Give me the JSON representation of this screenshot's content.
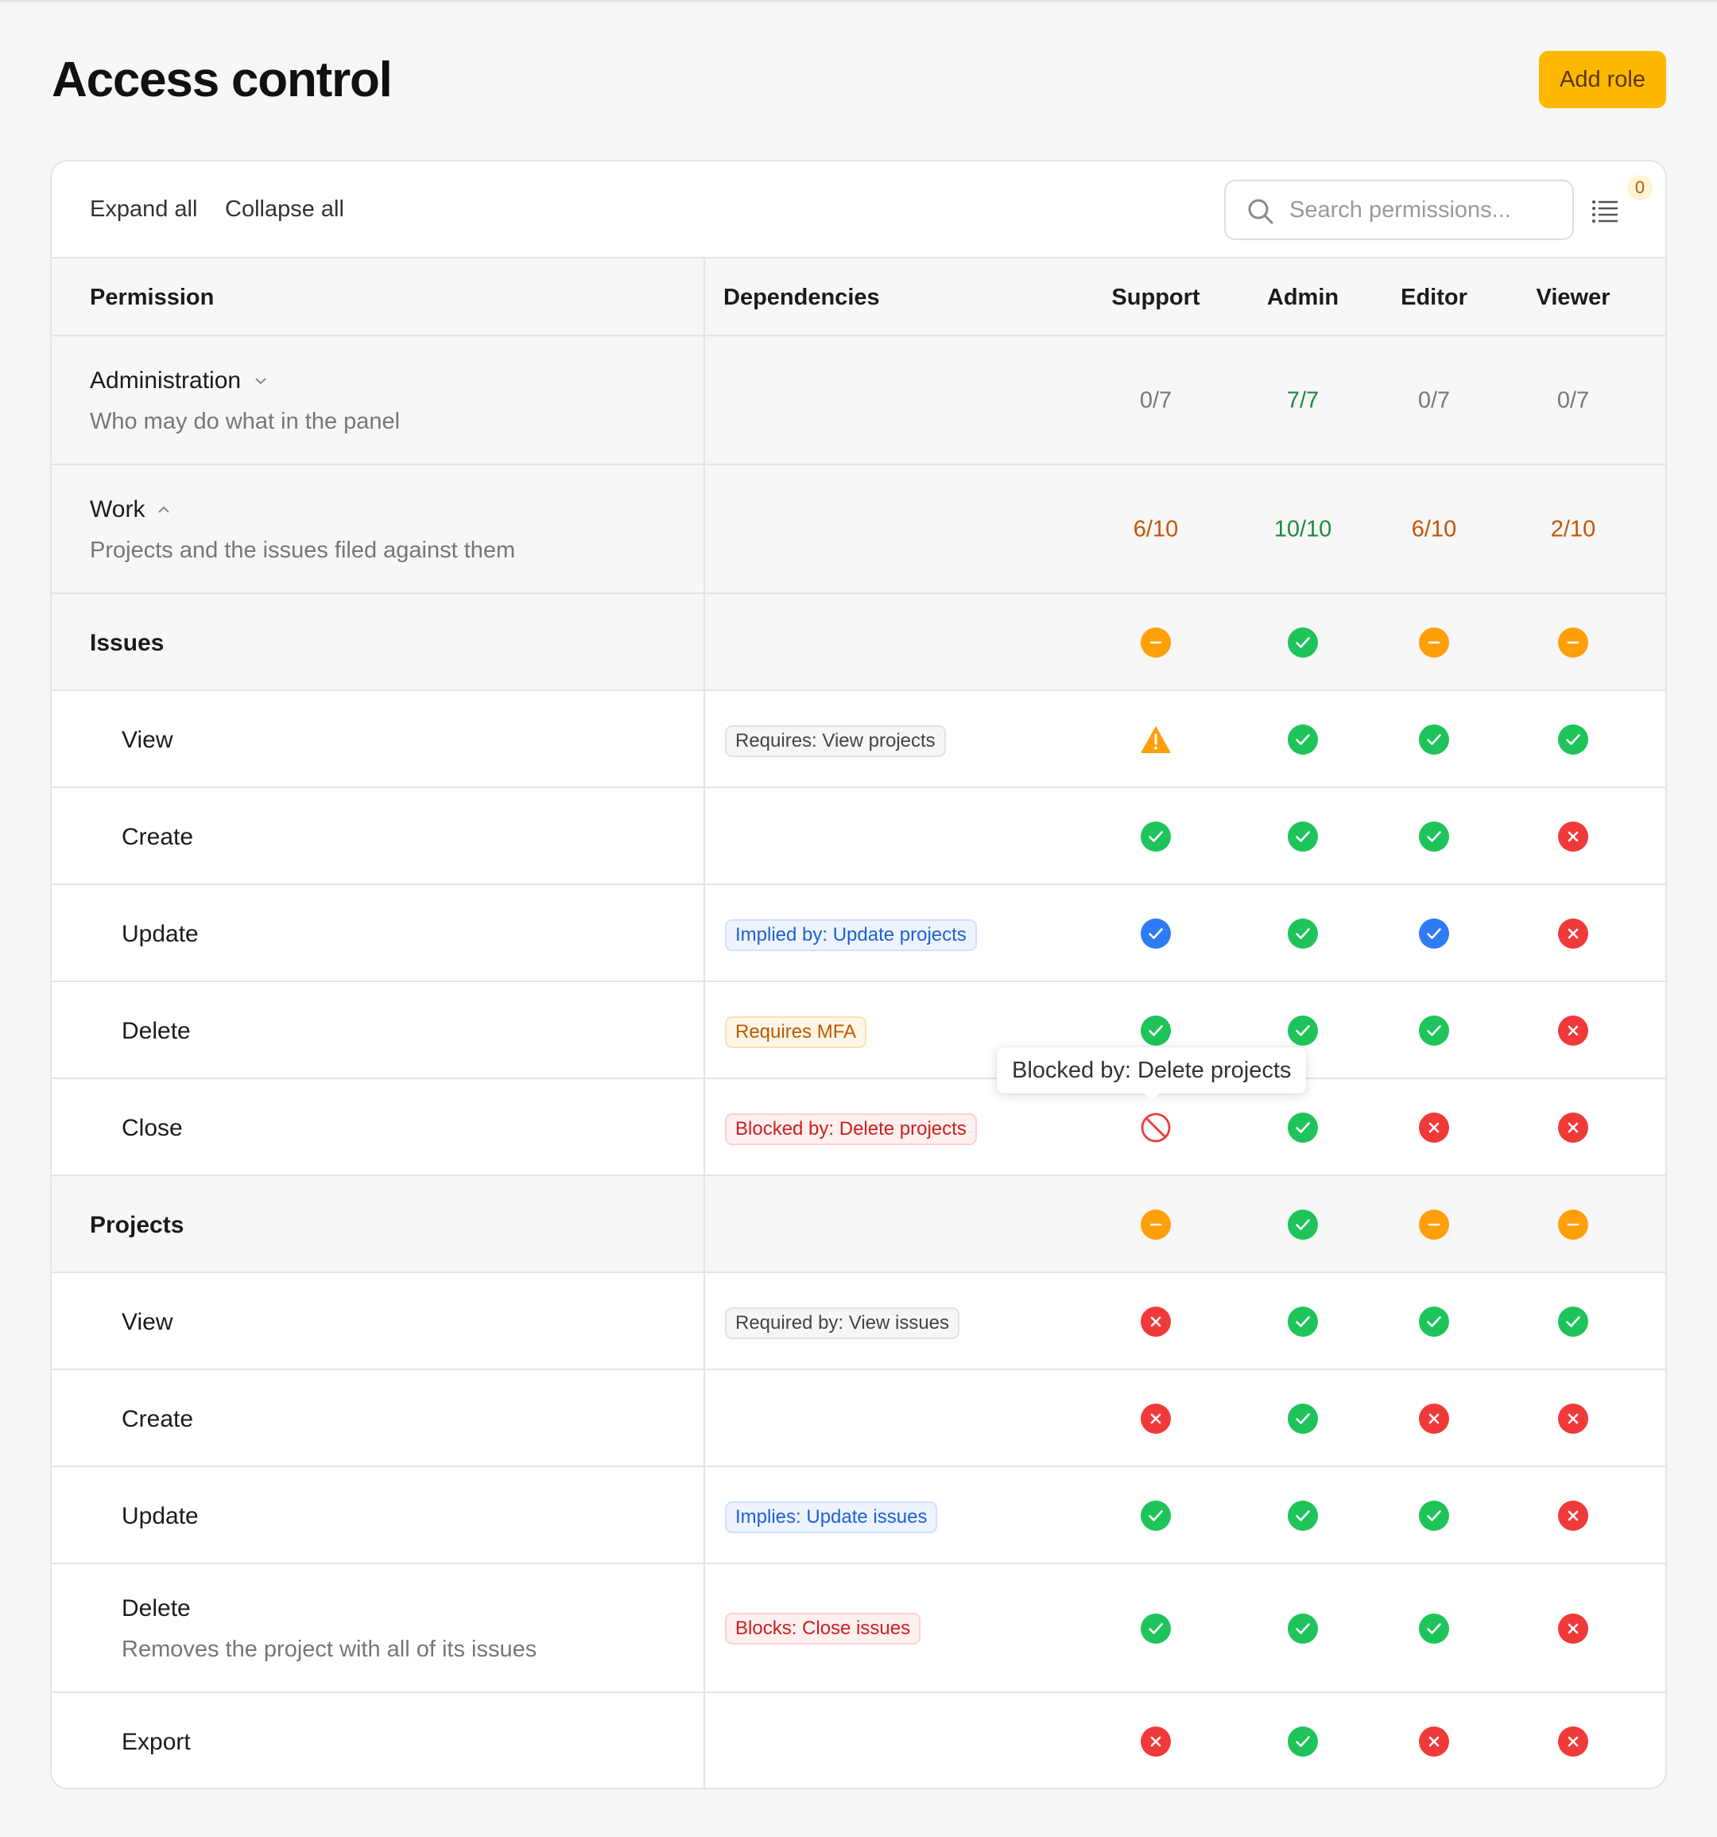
{
  "header": {
    "title": "Access control",
    "add_role_label": "Add role"
  },
  "toolbar": {
    "expand_label": "Expand all",
    "collapse_label": "Collapse all",
    "search_placeholder": "Search permissions...",
    "filter_count": "0"
  },
  "columns": {
    "permission": "Permission",
    "dependencies": "Dependencies",
    "roles": [
      "Support",
      "Admin",
      "Editor",
      "Viewer"
    ]
  },
  "colors": {
    "accent": "#ffb800",
    "check": "#1ec45a",
    "implied": "#2f7bf5",
    "partial": "#ff9f0a",
    "denied": "#f03a3a",
    "count_full": "#1d8a3c",
    "count_partial": "#c45500",
    "count_none": "#777777"
  },
  "groups": {
    "administration": {
      "name": "Administration",
      "description": "Who may do what in the panel",
      "counts": [
        "0/7",
        "7/7",
        "0/7",
        "0/7"
      ],
      "count_status": [
        "none",
        "full",
        "none",
        "none"
      ]
    },
    "work": {
      "name": "Work",
      "description": "Projects and the issues filed against them",
      "counts": [
        "6/10",
        "10/10",
        "6/10",
        "2/10"
      ],
      "count_status": [
        "partial",
        "full",
        "partial",
        "partial"
      ]
    }
  },
  "sections": {
    "issues": {
      "name": "Issues",
      "states": [
        "partial",
        "check",
        "partial",
        "partial"
      ],
      "rows": [
        {
          "name": "View",
          "tag": "Requires: View projects",
          "states": [
            "warning",
            "check",
            "check",
            "check"
          ]
        },
        {
          "name": "Create",
          "tag": "",
          "states": [
            "check",
            "check",
            "check",
            "denied"
          ]
        },
        {
          "name": "Update",
          "tag": "Implied by: Update projects",
          "states": [
            "implied",
            "check",
            "implied",
            "denied"
          ]
        },
        {
          "name": "Delete",
          "tag": "Requires MFA",
          "states": [
            "check",
            "check",
            "check",
            "denied"
          ]
        },
        {
          "name": "Close",
          "tag": "Blocked by: Delete projects",
          "states": [
            "blocked",
            "check",
            "denied",
            "denied"
          ]
        }
      ]
    },
    "projects": {
      "name": "Projects",
      "states": [
        "partial",
        "check",
        "partial",
        "partial"
      ],
      "rows": [
        {
          "name": "View",
          "tag": "Required by: View issues",
          "states": [
            "denied",
            "check",
            "check",
            "check"
          ]
        },
        {
          "name": "Create",
          "tag": "",
          "states": [
            "denied",
            "check",
            "denied",
            "denied"
          ]
        },
        {
          "name": "Update",
          "tag": "Implies: Update issues",
          "states": [
            "check",
            "check",
            "check",
            "denied"
          ]
        },
        {
          "name": "Delete",
          "description": "Removes the project with all of its issues",
          "tag": "Blocks: Close issues",
          "states": [
            "check",
            "check",
            "check",
            "denied"
          ]
        },
        {
          "name": "Export",
          "tag": "",
          "states": [
            "denied",
            "check",
            "denied",
            "denied"
          ]
        }
      ]
    }
  },
  "tooltip": {
    "text": "Blocked by: Delete projects"
  }
}
